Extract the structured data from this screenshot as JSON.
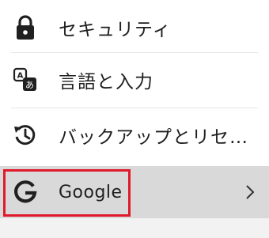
{
  "settings_list": {
    "items": [
      {
        "label": "セキュリティ",
        "icon": "lock-icon"
      },
      {
        "label": "言語と入力",
        "icon": "translate-icon"
      },
      {
        "label": "バックアップとリセ…",
        "icon": "backup-restore-icon"
      },
      {
        "label": "Google",
        "icon": "google-g-icon"
      }
    ],
    "translate_icon_glyphs": {
      "top": "A",
      "bottom": "あ"
    }
  },
  "colors": {
    "highlight_border": "#e0192b",
    "selected_row_background": "#d9d9d9",
    "icon": "#202020"
  }
}
